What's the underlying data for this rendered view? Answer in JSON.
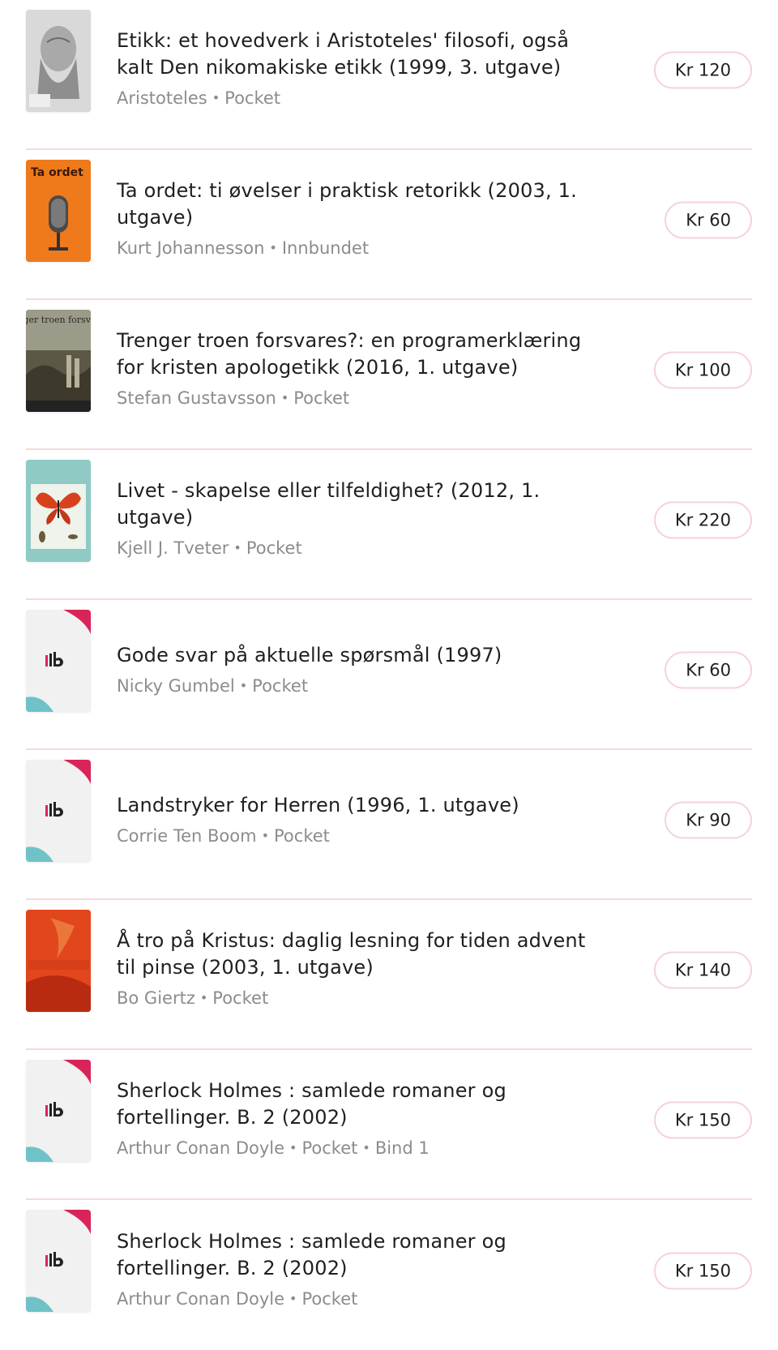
{
  "colors": {
    "divider": "#f6d9dc",
    "price_border": "#f5d3d7",
    "meta": "#8c8c8c",
    "brand_red": "#d9245a",
    "brand_teal": "#6fc3c8"
  },
  "items": [
    {
      "title": "Etikk: et hovedverk i Aristoteles' filosofi, også kalt Den nikomakiske etikk (1999, 3. utgave)",
      "author": "Aristoteles",
      "format": "Pocket",
      "extra": "",
      "price": "Kr 120",
      "cover": "aristoteles-bust-cover"
    },
    {
      "title": "Ta ordet: ti øvelser i praktisk retorikk (2003, 1. utgave)",
      "author": "Kurt Johannesson",
      "format": "Innbundet",
      "extra": "",
      "price": "Kr 60",
      "cover": "microphone-cover",
      "cover_text": "Ta ordet"
    },
    {
      "title": "Trenger troen forsvares?: en programerklæring for kristen apologetikk (2016, 1. utgave)",
      "author": "Stefan Gustavsson",
      "format": "Pocket",
      "extra": "",
      "price": "Kr 100",
      "cover": "painting-cover",
      "cover_text": "Trenger troen forsvares?"
    },
    {
      "title": "Livet - skapelse eller tilfeldighet? (2012, 1. utgave)",
      "author": "Kjell J. Tveter",
      "format": "Pocket",
      "extra": "",
      "price": "Kr 220",
      "cover": "butterfly-cover"
    },
    {
      "title": "Gode svar på aktuelle spørsmål (1997)",
      "author": "Nicky Gumbel",
      "format": "Pocket",
      "extra": "",
      "price": "Kr 60",
      "cover": "placeholder-cover"
    },
    {
      "title": "Landstryker for Herren (1996, 1. utgave)",
      "author": "Corrie Ten Boom",
      "format": "Pocket",
      "extra": "",
      "price": "Kr 90",
      "cover": "placeholder-cover"
    },
    {
      "title": "Å tro på Kristus: daglig lesning for tiden advent til pinse (2003, 1. utgave)",
      "author": "Bo Giertz",
      "format": "Pocket",
      "extra": "",
      "price": "Kr 140",
      "cover": "red-painting-cover"
    },
    {
      "title": "Sherlock Holmes : samlede romaner og fortellinger. B. 2 (2002)",
      "author": "Arthur Conan Doyle",
      "format": "Pocket",
      "extra": "Bind 1",
      "price": "Kr 150",
      "cover": "placeholder-cover"
    },
    {
      "title": "Sherlock Holmes : samlede romaner og fortellinger. B. 2 (2002)",
      "author": "Arthur Conan Doyle",
      "format": "Pocket",
      "extra": "",
      "price": "Kr 150",
      "cover": "placeholder-cover"
    }
  ]
}
